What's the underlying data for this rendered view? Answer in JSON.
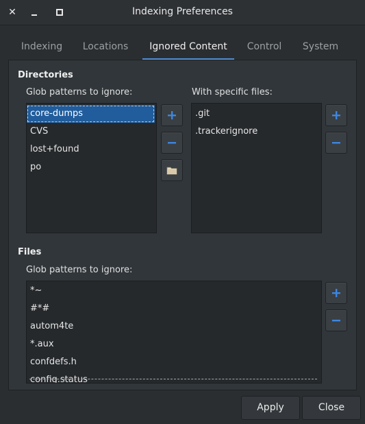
{
  "window": {
    "title": "Indexing Preferences",
    "close_glyph": "✕",
    "minimize_glyph": "—",
    "maximize_glyph": "□"
  },
  "tabs": [
    {
      "label": "Indexing"
    },
    {
      "label": "Locations"
    },
    {
      "label": "Ignored Content"
    },
    {
      "label": "Control"
    },
    {
      "label": "System"
    }
  ],
  "directories": {
    "section_title": "Directories",
    "glob_label": "Glob patterns to ignore:",
    "glob_patterns": [
      "core-dumps",
      "CVS",
      "lost+found",
      "po"
    ],
    "specific_label": "With specific files:",
    "specific_files": [
      ".git",
      ".trackerignore"
    ]
  },
  "files": {
    "section_title": "Files",
    "glob_label": "Glob patterns to ignore:",
    "glob_patterns": [
      "*~",
      "#*#",
      "autom4te",
      "*.aux",
      "confdefs.h",
      "config.status"
    ]
  },
  "buttons": {
    "apply": "Apply",
    "close": "Close"
  },
  "colors": {
    "accent": "#4f8fd9",
    "selection": "#215d9c",
    "plus": "#3d86e0"
  }
}
